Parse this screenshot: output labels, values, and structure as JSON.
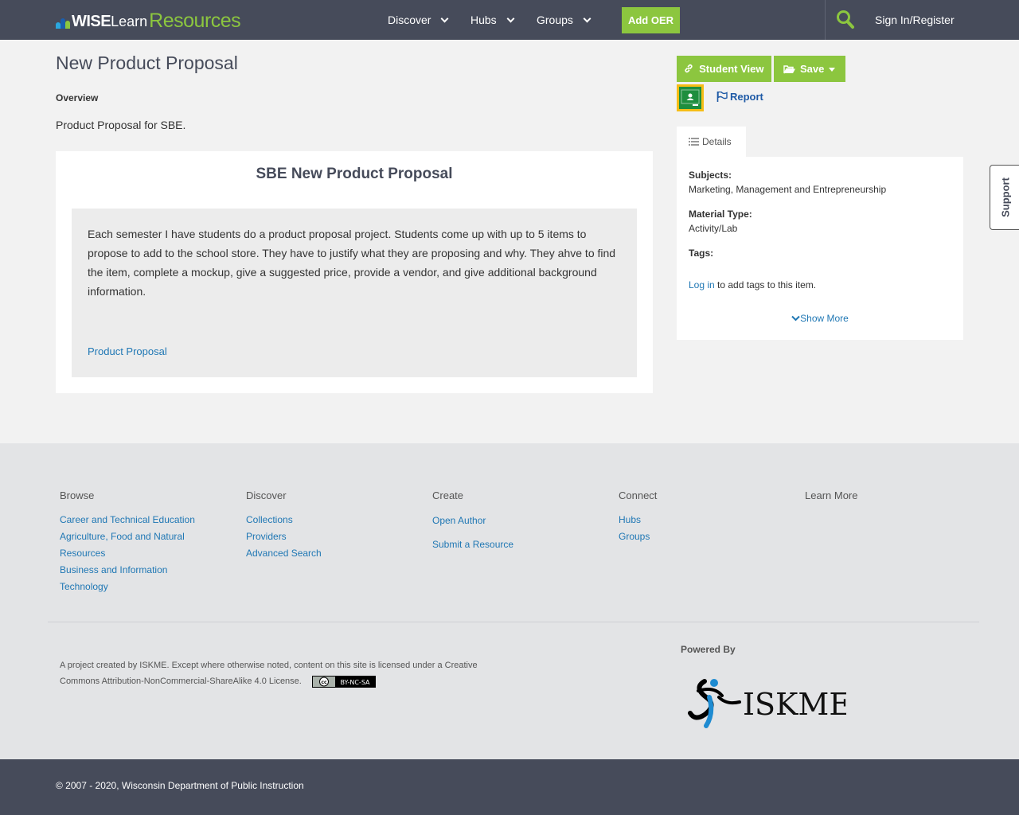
{
  "header": {
    "logo": {
      "wise": "WISE",
      "learn": "Learn",
      "resources": "Resources"
    },
    "nav": [
      {
        "label": "Discover"
      },
      {
        "label": "Hubs"
      },
      {
        "label": "Groups"
      }
    ],
    "add_oer": "Add OER",
    "sign_in": "Sign In/Register"
  },
  "main": {
    "title": "New Product Proposal",
    "overview_label": "Overview",
    "overview_text": "Product Proposal for SBE.",
    "card": {
      "title": "SBE New Product Proposal",
      "description": "Each semester I have students do a product proposal project.  Students come up with up to 5 items to propose to add to the school store.  They have to justify what they are proposing and why.  They ahve to find the item, complete a mockup, give a suggested price, provide a vendor, and give additional background information.",
      "link": "Product Proposal"
    }
  },
  "sidebar": {
    "student_view": "Student View",
    "save": "Save",
    "report": "Report",
    "details_tab": "Details",
    "subjects_label": "Subjects:",
    "subjects_value": "Marketing, Management and Entrepreneurship",
    "material_label": "Material Type:",
    "material_value": "Activity/Lab",
    "tags_label": "Tags:",
    "login_link": "Log in",
    "login_rest": " to add tags to this item.",
    "show_more": "Show More"
  },
  "support": "Support",
  "footer": {
    "browse": {
      "heading": "Browse",
      "links": [
        "Career and Technical Education",
        "Agriculture, Food and Natural Resources",
        "Business and Information Technology"
      ]
    },
    "discover": {
      "heading": "Discover",
      "links": [
        "Collections",
        "Providers",
        "Advanced Search"
      ]
    },
    "create": {
      "heading": "Create",
      "links": [
        "Open Author",
        "Submit a Resource"
      ]
    },
    "connect": {
      "heading": "Connect",
      "links": [
        "Hubs",
        "Groups"
      ]
    },
    "learn_more": {
      "heading": "Learn More"
    },
    "license": "A project created by ISKME. Except where otherwise noted, content on this site is licensed under a Creative Commons Attribution-NonCommercial-ShareAlike 4.0 License.",
    "cc_badge": "cc BY-NC-SA",
    "powered_by": "Powered By",
    "iskme_logo": "ISKME",
    "copyright": "© 2007 - 2020, Wisconsin Department of Public Instruction"
  },
  "colors": {
    "header_bg": "#464b5a",
    "accent_green": "#8cc63f",
    "link_blue": "#1f77b4",
    "page_bg": "#f2f2f2",
    "footer_bg": "#e3e4e6"
  }
}
